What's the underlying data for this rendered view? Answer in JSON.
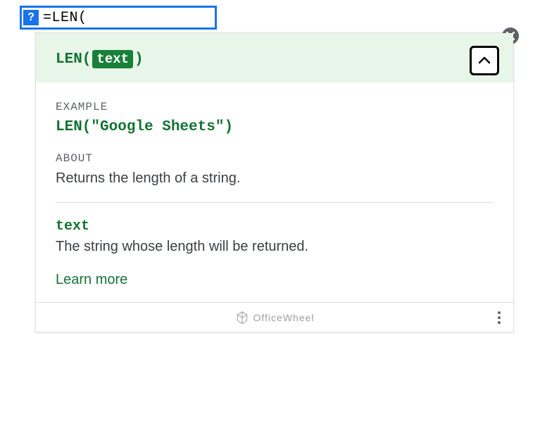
{
  "formula_bar": {
    "help_icon": "?",
    "formula": "=LEN("
  },
  "tooltip": {
    "signature": {
      "fn": "LEN(",
      "param": "text",
      "close": ")"
    },
    "example": {
      "label": "EXAMPLE",
      "code": "LEN(\"Google Sheets\")"
    },
    "about": {
      "label": "ABOUT",
      "text": "Returns the length of a string."
    },
    "param": {
      "name": "text",
      "desc": "The string whose length will be returned."
    },
    "learn_more": "Learn more"
  },
  "footer": {
    "brand": "OfficeWheel"
  }
}
